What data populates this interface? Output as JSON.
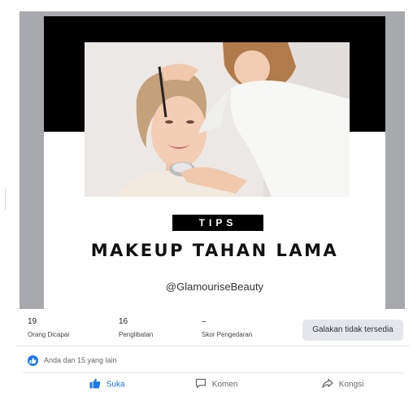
{
  "post": {
    "tag": "TIPS",
    "headline": "MAKEUP TAHAN LAMA",
    "handle": "@GlamouriseBeauty"
  },
  "stats": [
    {
      "value": "19",
      "label": "Orang Dicapai"
    },
    {
      "value": "16",
      "label": "Penglibatan"
    },
    {
      "value": "–",
      "label": "Skor Pengedaran"
    }
  ],
  "boost_button": "Galakan tidak tersedia",
  "reactions": {
    "text": "Anda dan 15 yang lain"
  },
  "actions": {
    "like": "Suka",
    "comment": "Komen",
    "share": "Kongsi"
  },
  "colors": {
    "accent": "#1877f2",
    "muted_text": "#65676b",
    "button_bg": "#e4e6eb",
    "image_bg": "#a7a9ad"
  },
  "icons": {
    "like": "thumbs-up-icon",
    "comment": "comment-icon",
    "share": "share-icon",
    "reaction": "like-reaction-icon"
  }
}
